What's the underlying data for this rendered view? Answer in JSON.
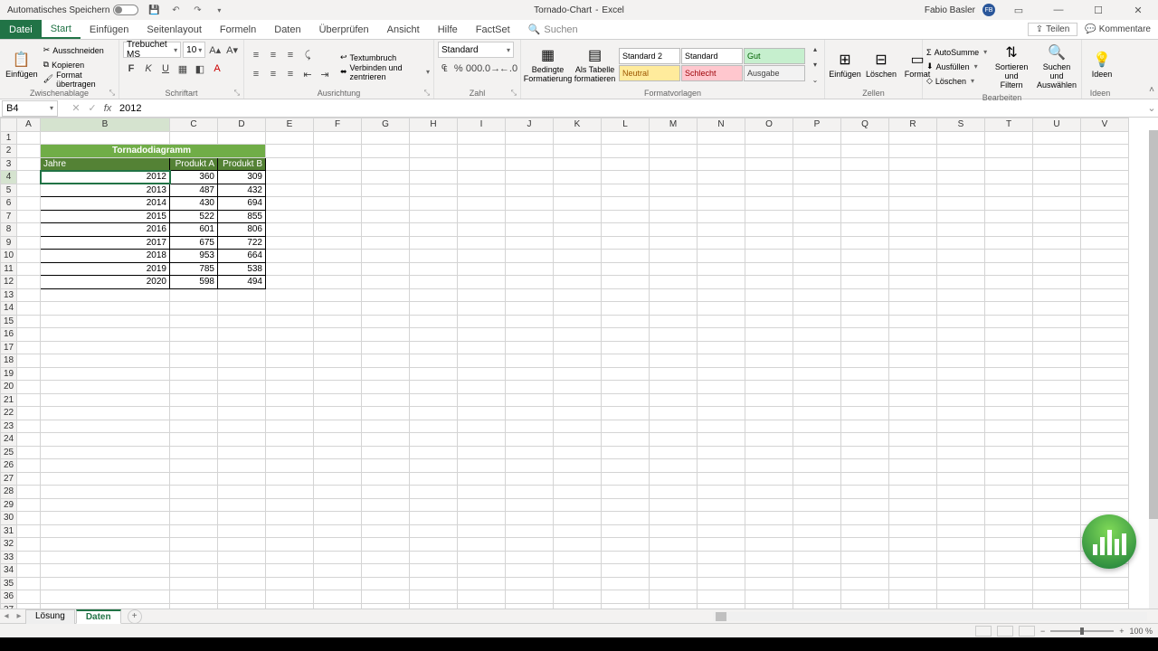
{
  "titlebar": {
    "autosave": "Automatisches Speichern",
    "doc_title": "Tornado-Chart",
    "app_name": "Excel",
    "username": "Fabio Basler",
    "initials": "FB"
  },
  "tabs": {
    "file": "Datei",
    "items": [
      "Start",
      "Einfügen",
      "Seitenlayout",
      "Formeln",
      "Daten",
      "Überprüfen",
      "Ansicht",
      "Hilfe",
      "FactSet"
    ],
    "active_index": 0,
    "search": "Suchen",
    "share": "Teilen",
    "comments": "Kommentare"
  },
  "ribbon": {
    "clipboard": {
      "paste": "Einfügen",
      "cut": "Ausschneiden",
      "copy": "Kopieren",
      "formatpainter": "Format übertragen",
      "label": "Zwischenablage"
    },
    "font": {
      "name": "Trebuchet MS",
      "size": "10",
      "label": "Schriftart"
    },
    "alignment": {
      "wrap": "Textumbruch",
      "merge": "Verbinden und zentrieren",
      "label": "Ausrichtung"
    },
    "number": {
      "format": "Standard",
      "label": "Zahl"
    },
    "styles": {
      "conditional": "Bedingte Formatierung",
      "astable": "Als Tabelle formatieren",
      "cells": [
        {
          "text": "Standard 2",
          "bg": "#fff",
          "color": "#000"
        },
        {
          "text": "Standard",
          "bg": "#fff",
          "color": "#000"
        },
        {
          "text": "Gut",
          "bg": "#c6efce",
          "color": "#006100"
        },
        {
          "text": "Neutral",
          "bg": "#ffeb9c",
          "color": "#9c5700"
        },
        {
          "text": "Schlecht",
          "bg": "#ffc7ce",
          "color": "#9c0006"
        },
        {
          "text": "Ausgabe",
          "bg": "#f2f2f2",
          "color": "#3f3f3f"
        }
      ],
      "label": "Formatvorlagen"
    },
    "cells_grp": {
      "insert": "Einfügen",
      "delete": "Löschen",
      "format": "Format",
      "label": "Zellen"
    },
    "editing": {
      "sum": "AutoSumme",
      "fill": "Ausfüllen",
      "clear": "Löschen",
      "sort": "Sortieren und Filtern",
      "find": "Suchen und Auswählen",
      "label": "Bearbeiten"
    },
    "ideas": {
      "label": "Ideen"
    }
  },
  "formula_bar": {
    "cell_ref": "B4",
    "formula": "2012"
  },
  "columns": [
    "A",
    "B",
    "C",
    "D",
    "E",
    "F",
    "G",
    "H",
    "I",
    "J",
    "K",
    "L",
    "M",
    "N",
    "O",
    "P",
    "Q",
    "R",
    "S",
    "T",
    "U",
    "V"
  ],
  "col_widths": {
    "A": 26,
    "B": 143,
    "C": 53,
    "D": 53,
    "default": 53
  },
  "rows_visible": 37,
  "selected_cell": {
    "row": 4,
    "col": "B"
  },
  "table": {
    "title": "Tornadodiagramm",
    "headers": [
      "Jahre",
      "Produkt A",
      "Produkt B"
    ],
    "rows": [
      [
        "2012",
        "360",
        "309"
      ],
      [
        "2013",
        "487",
        "432"
      ],
      [
        "2014",
        "430",
        "694"
      ],
      [
        "2015",
        "522",
        "855"
      ],
      [
        "2016",
        "601",
        "806"
      ],
      [
        "2017",
        "675",
        "722"
      ],
      [
        "2018",
        "953",
        "664"
      ],
      [
        "2019",
        "785",
        "538"
      ],
      [
        "2020",
        "598",
        "494"
      ]
    ]
  },
  "sheet_tabs": {
    "items": [
      "Lösung",
      "Daten"
    ],
    "active_index": 1
  },
  "statusbar": {
    "zoom": "100 %"
  }
}
